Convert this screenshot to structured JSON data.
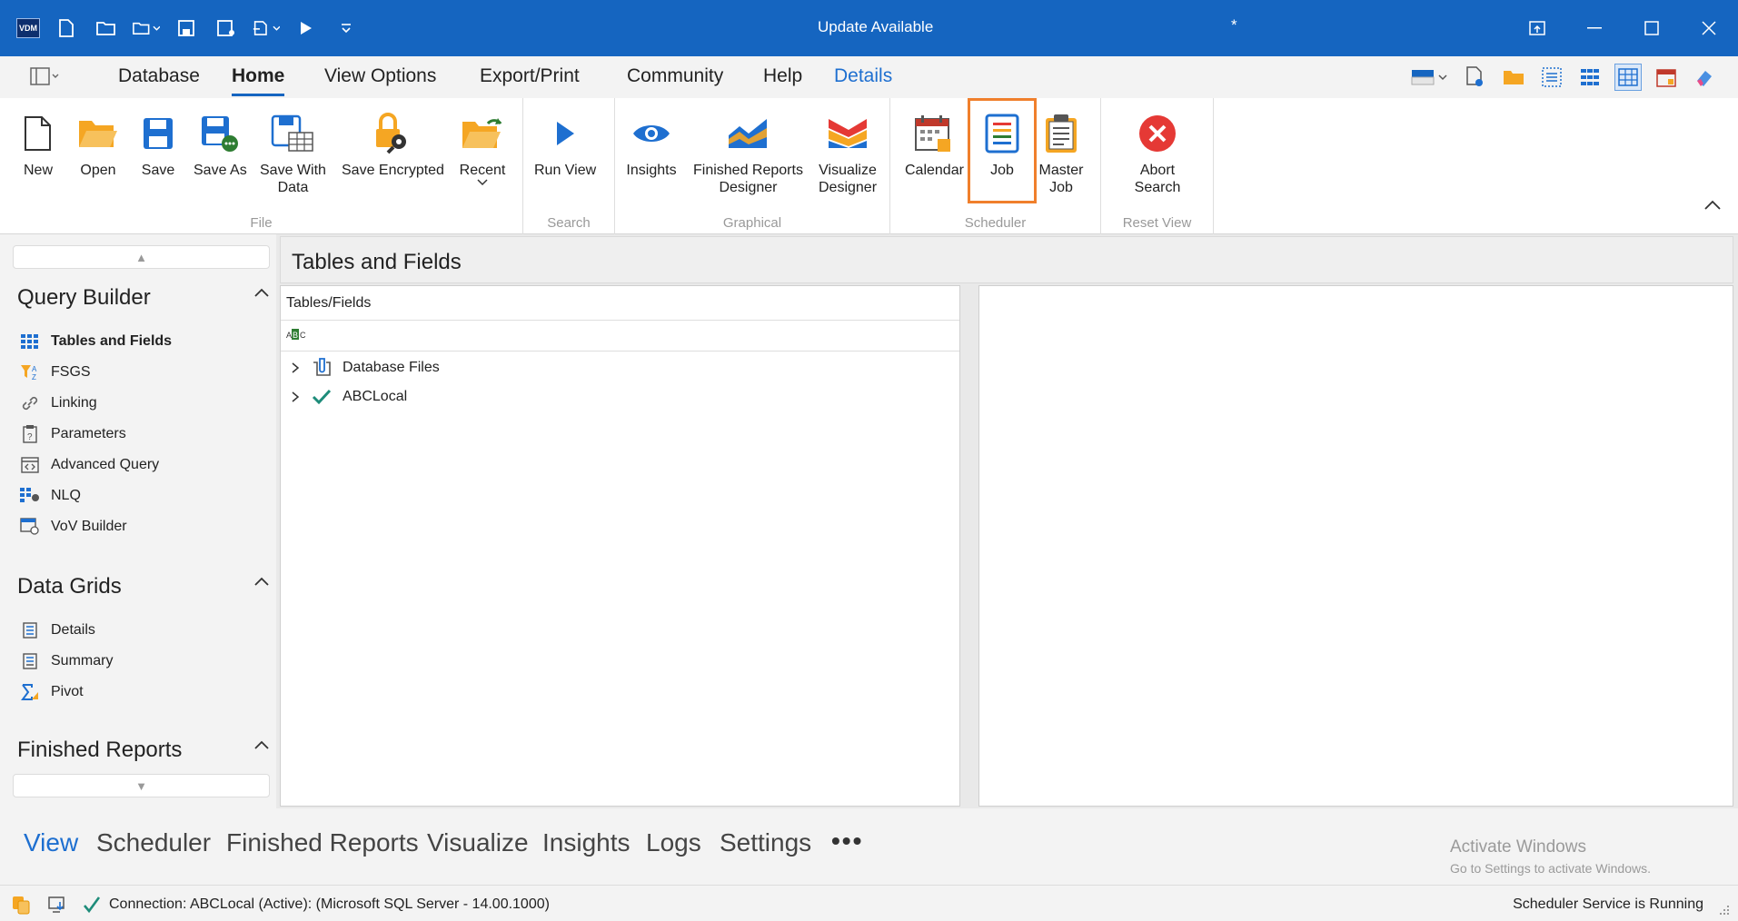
{
  "app": {
    "logo_text": "VDM",
    "title": "Update Available",
    "modified_marker": "*"
  },
  "menu": {
    "tabs": [
      "Database",
      "Home",
      "View Options",
      "Export/Print",
      "Community",
      "Help",
      "Details"
    ],
    "active": "Home"
  },
  "ribbon": {
    "groups": {
      "file": "File",
      "search": "Search",
      "graphical": "Graphical",
      "scheduler": "Scheduler",
      "reset_view": "Reset View"
    },
    "buttons": {
      "new": "New",
      "open": "Open",
      "save": "Save",
      "save_as": "Save As",
      "save_with_data": "Save With\nData",
      "save_encrypted": "Save Encrypted",
      "recent": "Recent",
      "run_view": "Run View",
      "insights": "Insights",
      "finished_reports_designer": "Finished Reports\nDesigner",
      "visualize_designer": "Visualize\nDesigner",
      "calendar": "Calendar",
      "job": "Job",
      "master_job": "Master\nJob",
      "abort_search": "Abort\nSearch"
    }
  },
  "leftnav": {
    "query_builder": {
      "header": "Query Builder",
      "items": [
        "Tables and Fields",
        "FSGS",
        "Linking",
        "Parameters",
        "Advanced Query",
        "NLQ",
        "VoV Builder"
      ]
    },
    "data_grids": {
      "header": "Data Grids",
      "items": [
        "Details",
        "Summary",
        "Pivot"
      ]
    },
    "finished_reports": {
      "header": "Finished Reports"
    }
  },
  "main": {
    "title": "Tables and Fields",
    "tree_header": "Tables/Fields",
    "tree_items": [
      "Database Files",
      "ABCLocal"
    ]
  },
  "bottomnav": {
    "items": [
      "View",
      "Scheduler",
      "Finished Reports",
      "Visualize",
      "Insights",
      "Logs",
      "Settings"
    ],
    "more": "•••",
    "active": "View"
  },
  "watermark": {
    "line1": "Activate Windows",
    "line2": "Go to Settings to activate Windows."
  },
  "status": {
    "connection": "Connection: ABCLocal (Active): (Microsoft SQL Server - 14.00.1000)",
    "scheduler": "Scheduler Service is Running"
  },
  "colors": {
    "titlebar": "#1565c0",
    "accent": "#1e6fd0",
    "highlight": "#f07f2c"
  }
}
